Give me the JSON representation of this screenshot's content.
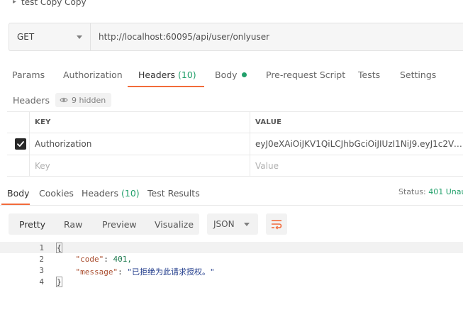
{
  "request": {
    "name": "test Copy Copy",
    "method": "GET",
    "url": "http://localhost:60095/api/user/onlyuser"
  },
  "request_tabs": {
    "params": "Params",
    "authorization": "Authorization",
    "headers": "Headers",
    "headers_count": "(10)",
    "body": "Body",
    "pre_request_script": "Pre-request Script",
    "tests": "Tests",
    "settings": "Settings"
  },
  "headers_section": {
    "label": "Headers",
    "hidden_count": "9 hidden",
    "columns": {
      "key": "KEY",
      "value": "VALUE"
    },
    "rows": [
      {
        "checked": true,
        "key": "Authorization",
        "value": "eyJ0eXAiOiJKV1QiLCJhbGciOiJIUzI1NiJ9.eyJ1c2VySW(..."
      }
    ],
    "new_row": {
      "key_placeholder": "Key",
      "value_placeholder": "Value"
    }
  },
  "response_tabs": {
    "body": "Body",
    "cookies": "Cookies",
    "headers": "Headers",
    "headers_count": "(10)",
    "test_results": "Test Results"
  },
  "response_status": {
    "label": "Status:",
    "code": "401 Unaut"
  },
  "response_toolbar": {
    "views": [
      "Pretty",
      "Raw",
      "Preview",
      "Visualize"
    ],
    "format": "JSON"
  },
  "response_body": {
    "lines": [
      {
        "num": "1",
        "text": "{"
      },
      {
        "num": "2",
        "key": "\"code\"",
        "value": "401,"
      },
      {
        "num": "3",
        "key": "\"message\"",
        "value": "\"已拒绝为此请求授权。\""
      },
      {
        "num": "4",
        "text": "}"
      }
    ]
  },
  "colors": {
    "accent": "#f26b3a",
    "success": "#22a06b"
  },
  "icons": {
    "eye": "eye-icon",
    "wrap": "wrap-lines-icon",
    "check": "checkmark-icon"
  }
}
